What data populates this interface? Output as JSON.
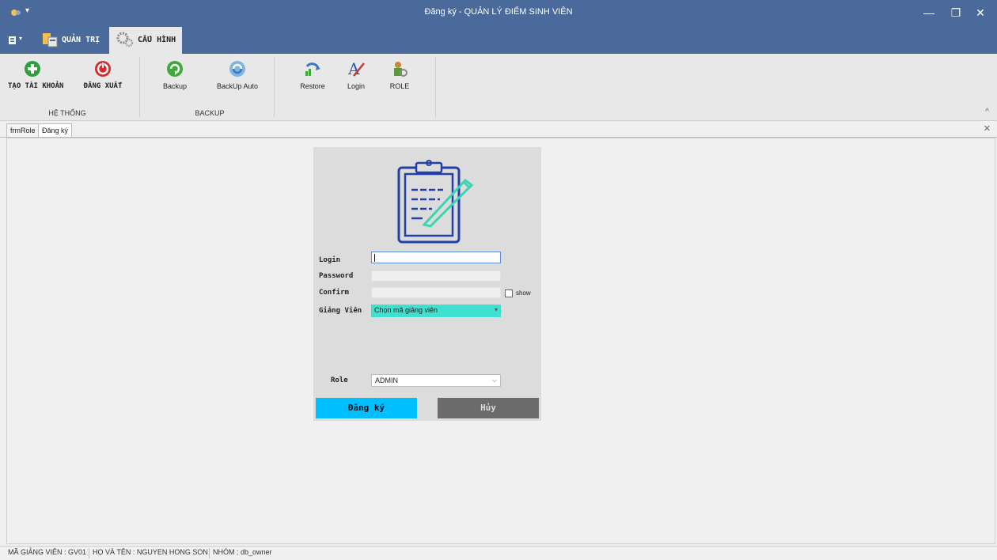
{
  "window": {
    "title": "Đăng ký - QUẢN LÝ ĐIỂM SINH VIÊN",
    "minimize": "—",
    "restore": "❐",
    "close": "✕"
  },
  "ribbon_tabs": [
    {
      "label": "QUẢN TRỊ",
      "icon": "admin-icon"
    },
    {
      "label": "CẤU HÌNH",
      "icon": "gears-icon"
    }
  ],
  "ribbon": {
    "groups": [
      {
        "label": "HỆ THỐNG",
        "buttons": [
          "TẠO TÀI KHOẢN",
          "ĐĂNG XUẤT"
        ]
      },
      {
        "label": "BACKUP",
        "buttons": [
          "Backup",
          "BackUp Auto"
        ]
      },
      {
        "label": "",
        "buttons": [
          "Restore",
          "Login",
          "ROLE"
        ]
      }
    ]
  },
  "doc_tabs": [
    "frmRole",
    "Đăng ký"
  ],
  "form": {
    "login_label": "Login",
    "password_label": "Password",
    "confirm_label": "Confirm",
    "show_label": "show",
    "giangvien_label": "Giảng Viên",
    "giangvien_value": "Chọn mã giảng viên",
    "role_label": "Role",
    "role_value": "ADMIN",
    "submit_label": "Đăng ký",
    "cancel_label": "Hủy"
  },
  "status": {
    "ma_gv": "MÃ GIẢNG VIÊN : GV01",
    "ho_ten": "HỌ VÀ TÊN : NGUYEN HONG SON",
    "nhom": "NHÓM : db_owner"
  },
  "colors": {
    "titlebar": "#4a6a9b",
    "submit_button": "#00bfff",
    "cancel_button": "#6b6b6b",
    "combo_giangvien": "#40e0d0"
  }
}
